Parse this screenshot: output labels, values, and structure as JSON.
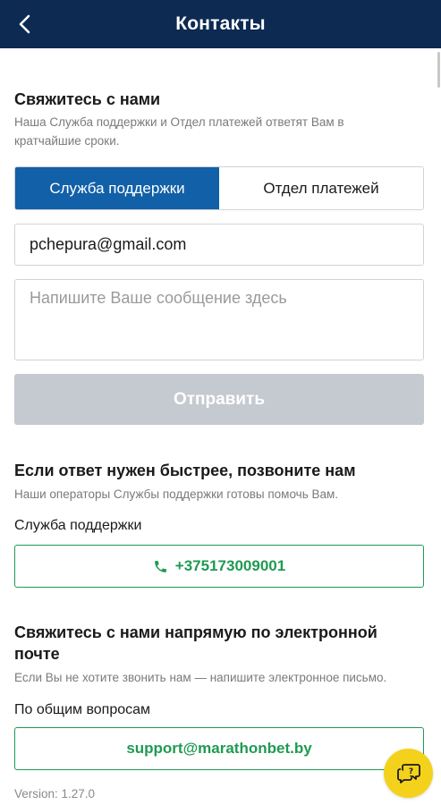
{
  "header": {
    "title": "Контакты",
    "back_icon": "chevron-left-icon",
    "background_color": "#0d2a52"
  },
  "contact_form": {
    "title": "Свяжитесь с нами",
    "subtitle": "Наша Служба поддержки и Отдел платежей ответят Вам в кратчайшие сроки.",
    "tabs": [
      {
        "label": "Служба поддержки",
        "active": true
      },
      {
        "label": "Отдел платежей",
        "active": false
      }
    ],
    "email_value": "pchepura@gmail.com",
    "message_placeholder": "Напишите Ваше сообщение здесь",
    "send_label": "Отправить",
    "accent_color": "#1260a8"
  },
  "call_section": {
    "title": "Если ответ нужен быстрее, позвоните нам",
    "subtitle": "Наши операторы Службы поддержки готовы помочь Вам.",
    "label": "Служба поддержки",
    "phone": "+375173009001",
    "phone_icon": "phone-icon",
    "color": "#1f9a52"
  },
  "email_section": {
    "title": "Свяжитесь с нами напрямую по электронной почте",
    "subtitle": "Если Вы не хотите звонить нам — напишите электронное письмо.",
    "label": "По общим вопросам",
    "email": "support@marathonbet.by"
  },
  "footer": {
    "version": "Version: 1.27.0"
  },
  "chat_button": {
    "icon": "chat-help-icon",
    "color": "#f4d21c"
  }
}
